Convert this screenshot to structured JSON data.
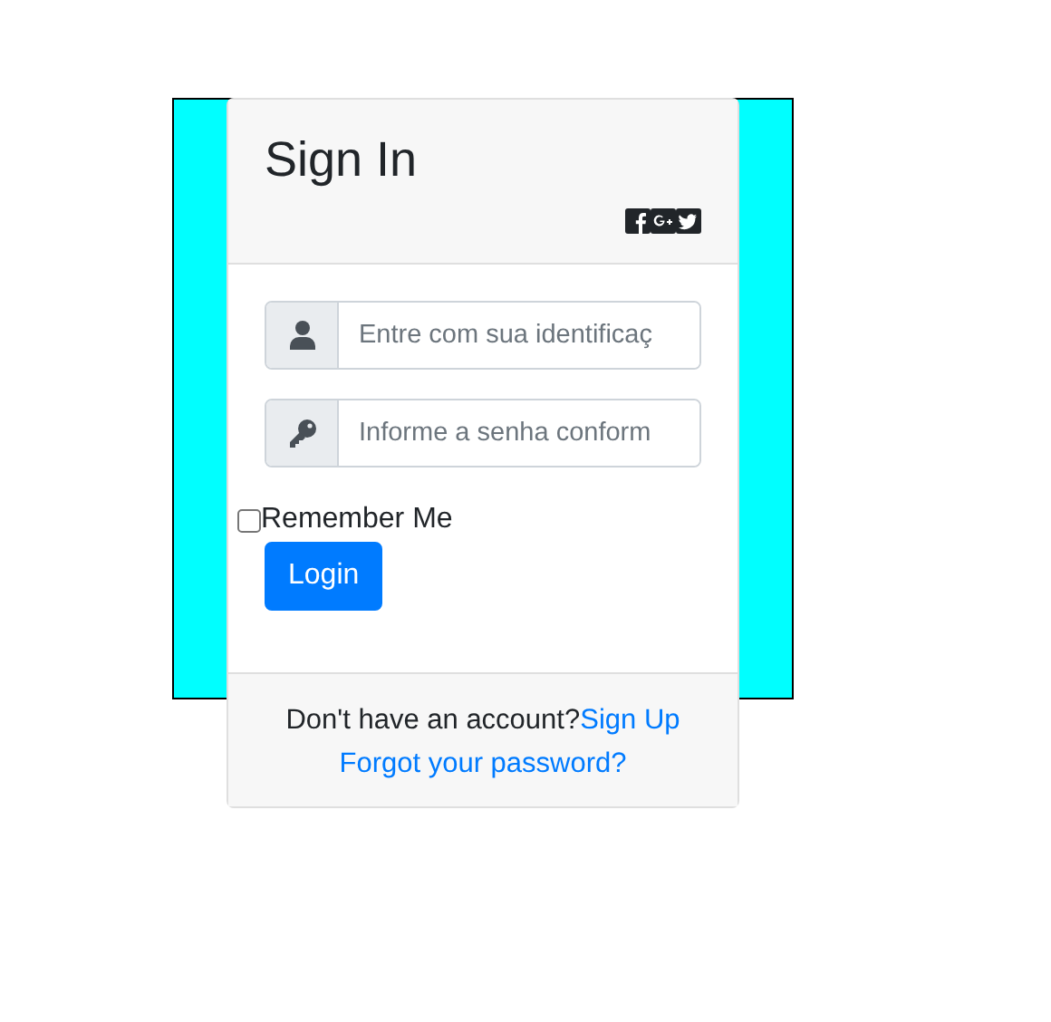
{
  "card": {
    "title": "Sign In",
    "fields": [
      {
        "kind": "user",
        "placeholder": "Entre com sua identificaç"
      },
      {
        "kind": "key",
        "placeholder": "Informe a senha conform"
      }
    ],
    "remember": {
      "label": "Remember Me",
      "checked": false
    },
    "login_button": "Login",
    "footer": {
      "prompt": "Don't have an account?",
      "signup_link": "Sign Up",
      "forgot_link": "Forgot your password?"
    }
  }
}
